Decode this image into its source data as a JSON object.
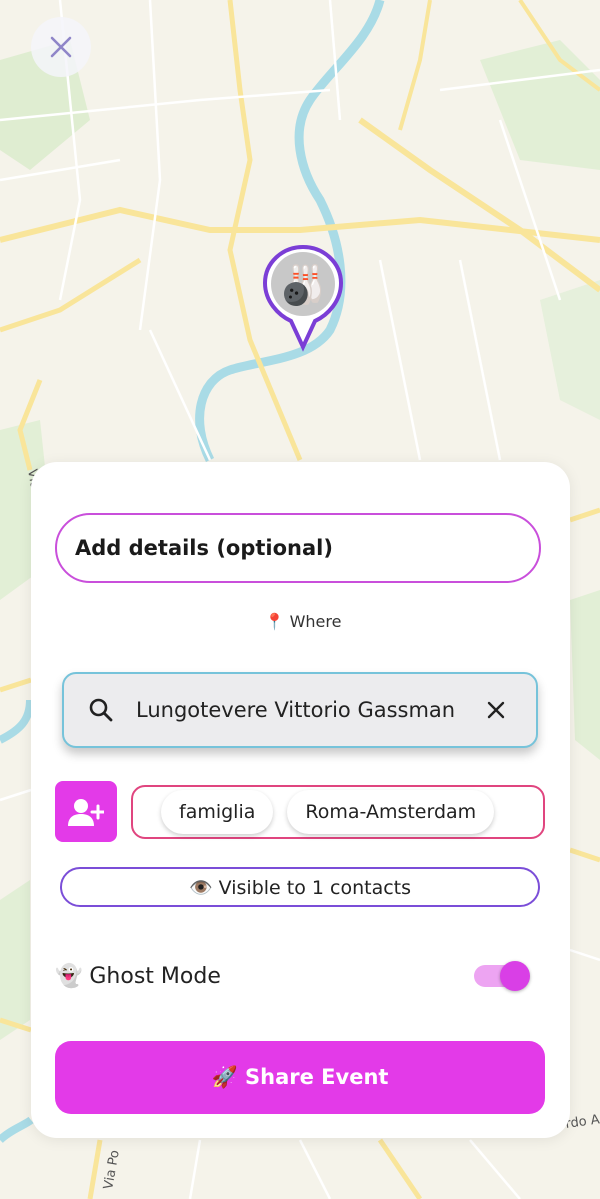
{
  "map": {
    "street_label_1": "Via",
    "street_label_2": "Via Po",
    "street_label_3": "rdo A"
  },
  "close": {
    "icon": "close-icon"
  },
  "pin": {
    "emoji": "🎳"
  },
  "details": {
    "label": "Add details (optional)"
  },
  "where": {
    "icon": "📍",
    "label": "Where"
  },
  "search": {
    "value": "Lungotevere Vittorio Gassman",
    "icon": "search-icon",
    "clear_icon": "close-icon"
  },
  "groups": {
    "items": [
      {
        "label": "famiglia"
      },
      {
        "label": "Roma-Amsterdam"
      }
    ]
  },
  "visibility": {
    "label": "👁️ Visible to 1 contacts"
  },
  "ghost_mode": {
    "label": "👻 Ghost Mode",
    "enabled": true
  },
  "share": {
    "label": "🚀 Share Event"
  },
  "colors": {
    "accent": "#e33ae8",
    "pin_border": "#7b3ed6",
    "search_border": "#76c3da",
    "groups_border": "#e0457f"
  }
}
